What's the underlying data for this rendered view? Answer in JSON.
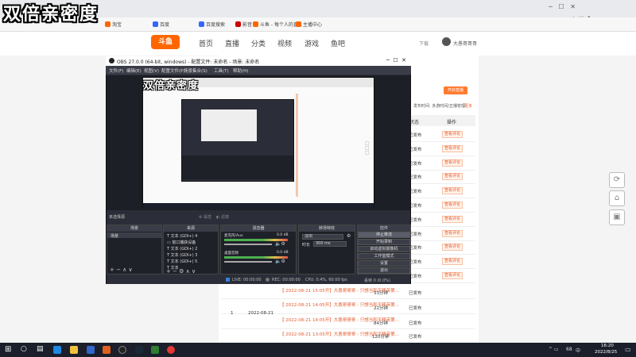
{
  "overlay": {
    "title": "双倍亲密度",
    "preview_title": "双倍亲密度"
  },
  "browser": {
    "bookmarks": [
      "淘宝",
      "百度",
      "百度搜索",
      "斗鱼 - 每个人的直...",
      "主播中心"
    ],
    "bookmark_extra": [
      "影音"
    ]
  },
  "site": {
    "logo": "斗鱼",
    "nav": [
      "首页",
      "直播",
      "分类",
      "视频",
      "游戏",
      "鱼吧"
    ],
    "download": "下载",
    "user": "大愚哥哥哥"
  },
  "panel": {
    "top_button": "开启直播",
    "filter_text": "发布时间: 多游时间/正播管理",
    "filter_link": "更多",
    "col_status": "状态",
    "col_action": "操作",
    "status_published": "已发布",
    "action_label": "查看评论",
    "rows": [
      {
        "date": "",
        "link": "",
        "dur": "",
        "status": "已发布",
        "action": "查看评论"
      },
      {
        "date": "",
        "link": "",
        "dur": "",
        "status": "已发布",
        "action": "查看评论"
      },
      {
        "date": "",
        "link": "",
        "dur": "",
        "status": "已发布",
        "action": "查看评论"
      },
      {
        "date": "",
        "link": "",
        "dur": "",
        "status": "已发布",
        "action": "查看评论"
      },
      {
        "date": "",
        "link": "",
        "dur": "",
        "status": "已发布",
        "action": "查看评论"
      },
      {
        "date": "",
        "link": "",
        "dur": "",
        "status": "已发布",
        "action": "查看评论"
      },
      {
        "date": "",
        "link": "",
        "dur": "",
        "status": "已发布",
        "action": "查看评论"
      },
      {
        "date": "",
        "link": "",
        "dur": "",
        "status": "已发布",
        "action": "查看评论"
      },
      {
        "date": "",
        "link": "",
        "dur": "",
        "status": "已发布",
        "action": "查看评论"
      },
      {
        "date": "",
        "link": "",
        "dur": "",
        "status": "已发布",
        "action": "查看评论"
      },
      {
        "date": "",
        "link": "",
        "dur": "",
        "status": "已发布",
        "action": "查看评论"
      }
    ],
    "bottom_rows": [
      {
        "link": "【 2022-08-21 15:05开】大愚哥哥哥 - 只想当和平精英第...",
        "dur": "53分钟",
        "status": "已发布"
      },
      {
        "link": "【 2022-08-21 14:05开】大愚哥哥哥 - 只想当和平精英第...",
        "dur": "22分钟",
        "status": "已发布"
      },
      {
        "link": "【 2022-08-21 14:05开】大愚哥哥哥 - 只想当和平精英第...",
        "dur": "84分钟",
        "status": "已发布"
      },
      {
        "link": "【 2022-08-21 13:05开】大愚哥哥哥 - 只想当和平精英第...",
        "dur": "120分钟",
        "status": "已发布"
      }
    ],
    "group_index": "1",
    "group_date": "2022-08-21"
  },
  "obs": {
    "title": "OBS 27.0.0 (64-bit, windows) - 配置文件: 未命名 - 场景: 未命名",
    "menu": [
      "文件(F)",
      "编辑(E)",
      "视图(V)",
      "配置文件(P)",
      "场景集合(S)",
      "工具(T)",
      "帮助(H)"
    ],
    "no_source": "未选择源",
    "props_btn": "属性",
    "filters_btn": "滤镜",
    "docks": {
      "scenes": "场景",
      "sources": "来源",
      "mixer": "混音器",
      "transitions": "转场特效",
      "controls": "控件"
    },
    "scene_item": "场景",
    "sources": [
      "文本 (GDI+) 4",
      "窗口捕获设备",
      "文本 (GDI+) 2",
      "文本 (GDI+) 3",
      "文本 (GDI+) 5",
      "文本"
    ],
    "mixer": [
      {
        "name": "桌面音频",
        "db": "0.0 dB"
      },
      {
        "name": "麦克风/Aux",
        "db": "0.0 dB"
      }
    ],
    "transition": {
      "type": "淡出",
      "duration_label": "时长",
      "duration": "300 ms"
    },
    "controls": [
      "停止推流",
      "开始录制",
      "启动虚拟摄像机",
      "工作室模式",
      "设置",
      "退出"
    ],
    "status": {
      "live": "LIVE: 00:00:00",
      "rec": "REC: 00:00:00",
      "cpu": "CPU: 0.4%, 60.00 fps",
      "dropped": "丢帧 0 (0.0%)"
    }
  },
  "taskbar": {
    "time": "16:20",
    "date": "2022/8/25",
    "lang": "中",
    "volume": "68"
  },
  "colors": {
    "accent": "#e55b2c",
    "obs_bg": "#2b2e38",
    "taskbar": "#1a1f2b"
  }
}
